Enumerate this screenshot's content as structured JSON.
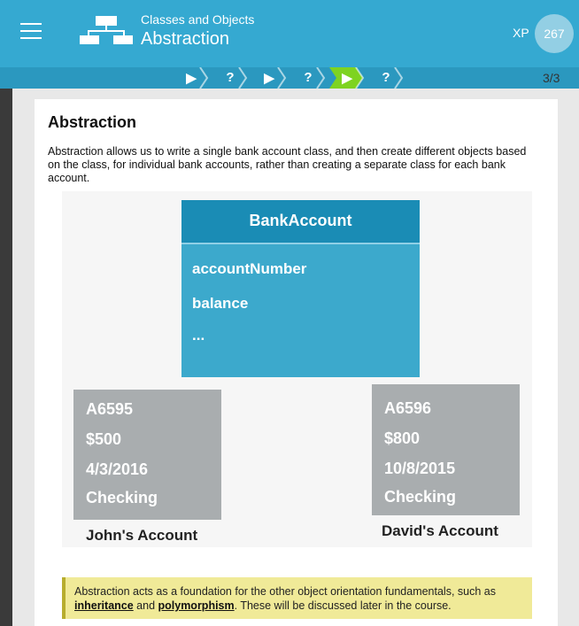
{
  "header": {
    "subtitle": "Classes and Objects",
    "title": "Abstraction",
    "xp_label": "XP",
    "xp_value": "267"
  },
  "progress": {
    "steps": [
      {
        "glyph": "▶",
        "type": "play",
        "state": "done"
      },
      {
        "glyph": "?",
        "type": "quiz",
        "state": "done"
      },
      {
        "glyph": "▶",
        "type": "play",
        "state": "done"
      },
      {
        "glyph": "?",
        "type": "quiz",
        "state": "done"
      },
      {
        "glyph": "▶",
        "type": "play",
        "state": "current"
      },
      {
        "glyph": "?",
        "type": "quiz",
        "state": "upcoming"
      }
    ],
    "counter": "3/3",
    "colors": {
      "step": "#35a9d1",
      "current": "#7ed321"
    }
  },
  "lesson": {
    "heading": "Abstraction",
    "body": "Abstraction allows us to write a single bank account class, and then create different objects based on the class, for individual bank accounts, rather than creating a separate class for each bank account.",
    "diagram": {
      "class_name": "BankAccount",
      "fields": [
        "accountNumber",
        "balance",
        "..."
      ],
      "objects": [
        {
          "lines": [
            "A6595",
            "$500",
            "4/3/2016",
            "Checking"
          ],
          "caption": "John's Account"
        },
        {
          "lines": [
            "A6596",
            "$800",
            "10/8/2015",
            "Checking"
          ],
          "caption": "David's Account"
        }
      ]
    },
    "note": {
      "prefix": "Abstraction acts as a foundation for the other object orientation fundamentals, such as ",
      "link1": "inheritance",
      "middle": " and ",
      "link2": "polymorphism",
      "suffix": ". These will be discussed later in the course."
    }
  },
  "colors": {
    "header": "#35a9d1",
    "class_header": "#1a8cb5",
    "class_body": "#3ca9cc",
    "object_box": "#a9adaf",
    "note_bg": "#f0ea98"
  }
}
